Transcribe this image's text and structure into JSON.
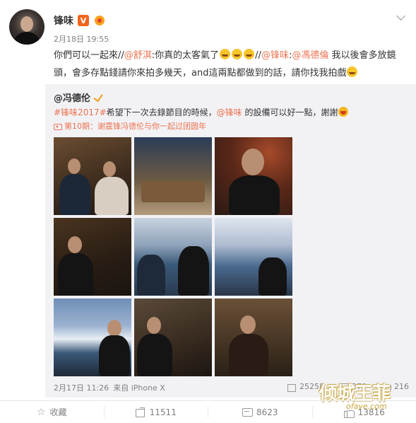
{
  "post": {
    "author": "锋味",
    "time": "2月18日 19:55",
    "text_parts": {
      "p1": "你們可以一起來//",
      "m1": "@舒淇",
      "p2": ":你真的太客氣了",
      "p3": "//",
      "m2": "@锋味",
      "p4": ":",
      "m3": "@馮德倫",
      "p5": " 我以後會多放鏡頭，會多存點錢請你來拍多幾天，and這兩點都做到的話，請你找我拍戲"
    }
  },
  "repost": {
    "author": "@冯德伦",
    "topic": "#锋味2017#",
    "text_a": "希望下一次去錄節目的時候，",
    "mention": "@锋味",
    "text_b": " 的設備可以好一點，謝謝",
    "episode_link": "第10期：谢霆锋冯德伦与你一起过团圆年",
    "footer_time": "2月17日 11:26",
    "footer_source": "来自 iPhone X",
    "stats": {
      "shares": "25258",
      "comments": "279",
      "likes": "216"
    }
  },
  "watermark": {
    "big": "倾城王菲",
    "small": "ofaye.com"
  },
  "actions": {
    "favorite_label": "收藏",
    "share_count": "11511",
    "comment_count": "8623",
    "like_count": "13816"
  },
  "photos": [
    "photo-1",
    "photo-2",
    "photo-3",
    "photo-4",
    "photo-5",
    "photo-6",
    "photo-7",
    "photo-8",
    "photo-9"
  ],
  "colors": {
    "link": "#eb7350",
    "muted": "#808080",
    "repost_bg": "#f2f2f5"
  }
}
